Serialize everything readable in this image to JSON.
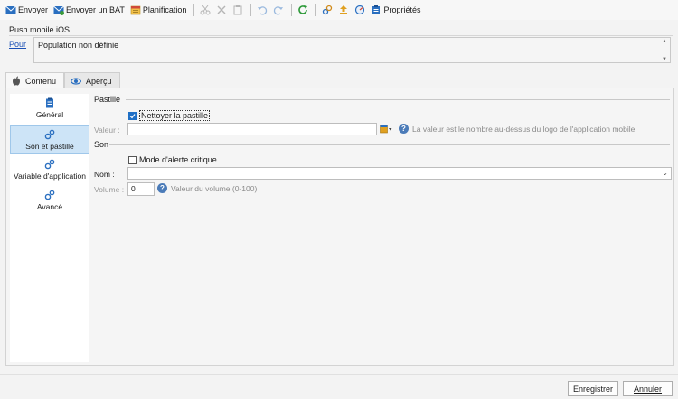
{
  "toolbar": {
    "send": "Envoyer",
    "send_proof": "Envoyer un BAT",
    "schedule": "Planification",
    "properties": "Propriétés"
  },
  "header": {
    "title": "Push mobile iOS",
    "for_link": "Pour",
    "population": "Population non définie"
  },
  "tabs": [
    {
      "label": "Contenu",
      "icon": "apple-icon",
      "active": true
    },
    {
      "label": "Aperçu",
      "icon": "eye-icon",
      "active": false
    }
  ],
  "nav": {
    "items": [
      {
        "label": "Général",
        "icon": "clipboard-icon"
      },
      {
        "label": "Son et pastille",
        "icon": "gears-icon",
        "selected": true
      },
      {
        "label": "Variable d'application",
        "icon": "gears-icon"
      },
      {
        "label": "Avancé",
        "icon": "gears-icon"
      }
    ]
  },
  "badge": {
    "section": "Pastille",
    "clear_badge": "Nettoyer la pastille",
    "clear_badge_checked": true,
    "value_label": "Valeur :",
    "value": "",
    "value_hint": "La valeur est le nombre au-dessus du logo de l'application mobile."
  },
  "sound": {
    "section": "Son",
    "critical_alert": "Mode d'alerte critique",
    "critical_alert_checked": false,
    "name_label": "Nom :",
    "name_value": "",
    "volume_label": "Volume :",
    "volume_value": "0",
    "volume_hint": "Valeur du volume (0-100)"
  },
  "footer": {
    "save": "Enregistrer",
    "cancel": "Annuler"
  },
  "colors": {
    "accent": "#1f6fc5",
    "selection": "#cde4f7",
    "link": "#1a4fb5"
  }
}
